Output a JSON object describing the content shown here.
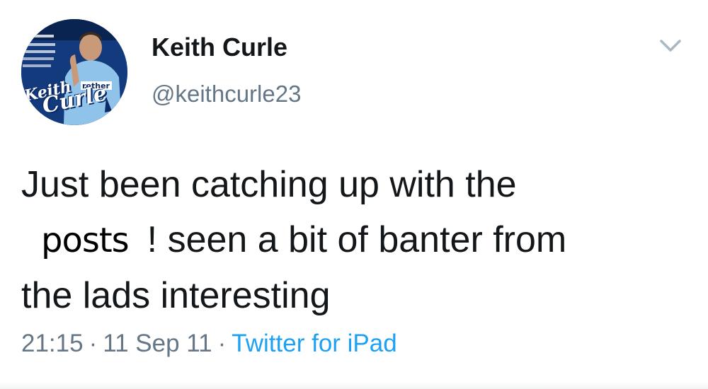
{
  "user": {
    "display_name": "Keith Curle",
    "handle": "@keithcurle23",
    "avatar_logo_line1": "Keith",
    "avatar_logo_line2": "Curle"
  },
  "tweet": {
    "line1": "Just been catching up with the",
    "redacted_word": "posts",
    "line2_rest": "! seen a bit of banter from",
    "line3": "the lads interesting"
  },
  "meta": {
    "time": "21:15",
    "separator": "·",
    "date": "11 Sep 11",
    "source": "Twitter for iPad"
  },
  "icons": {
    "menu": "chevron-down-icon"
  },
  "colors": {
    "text": "#14171a",
    "secondary": "#657786",
    "link": "#1da1f2"
  }
}
